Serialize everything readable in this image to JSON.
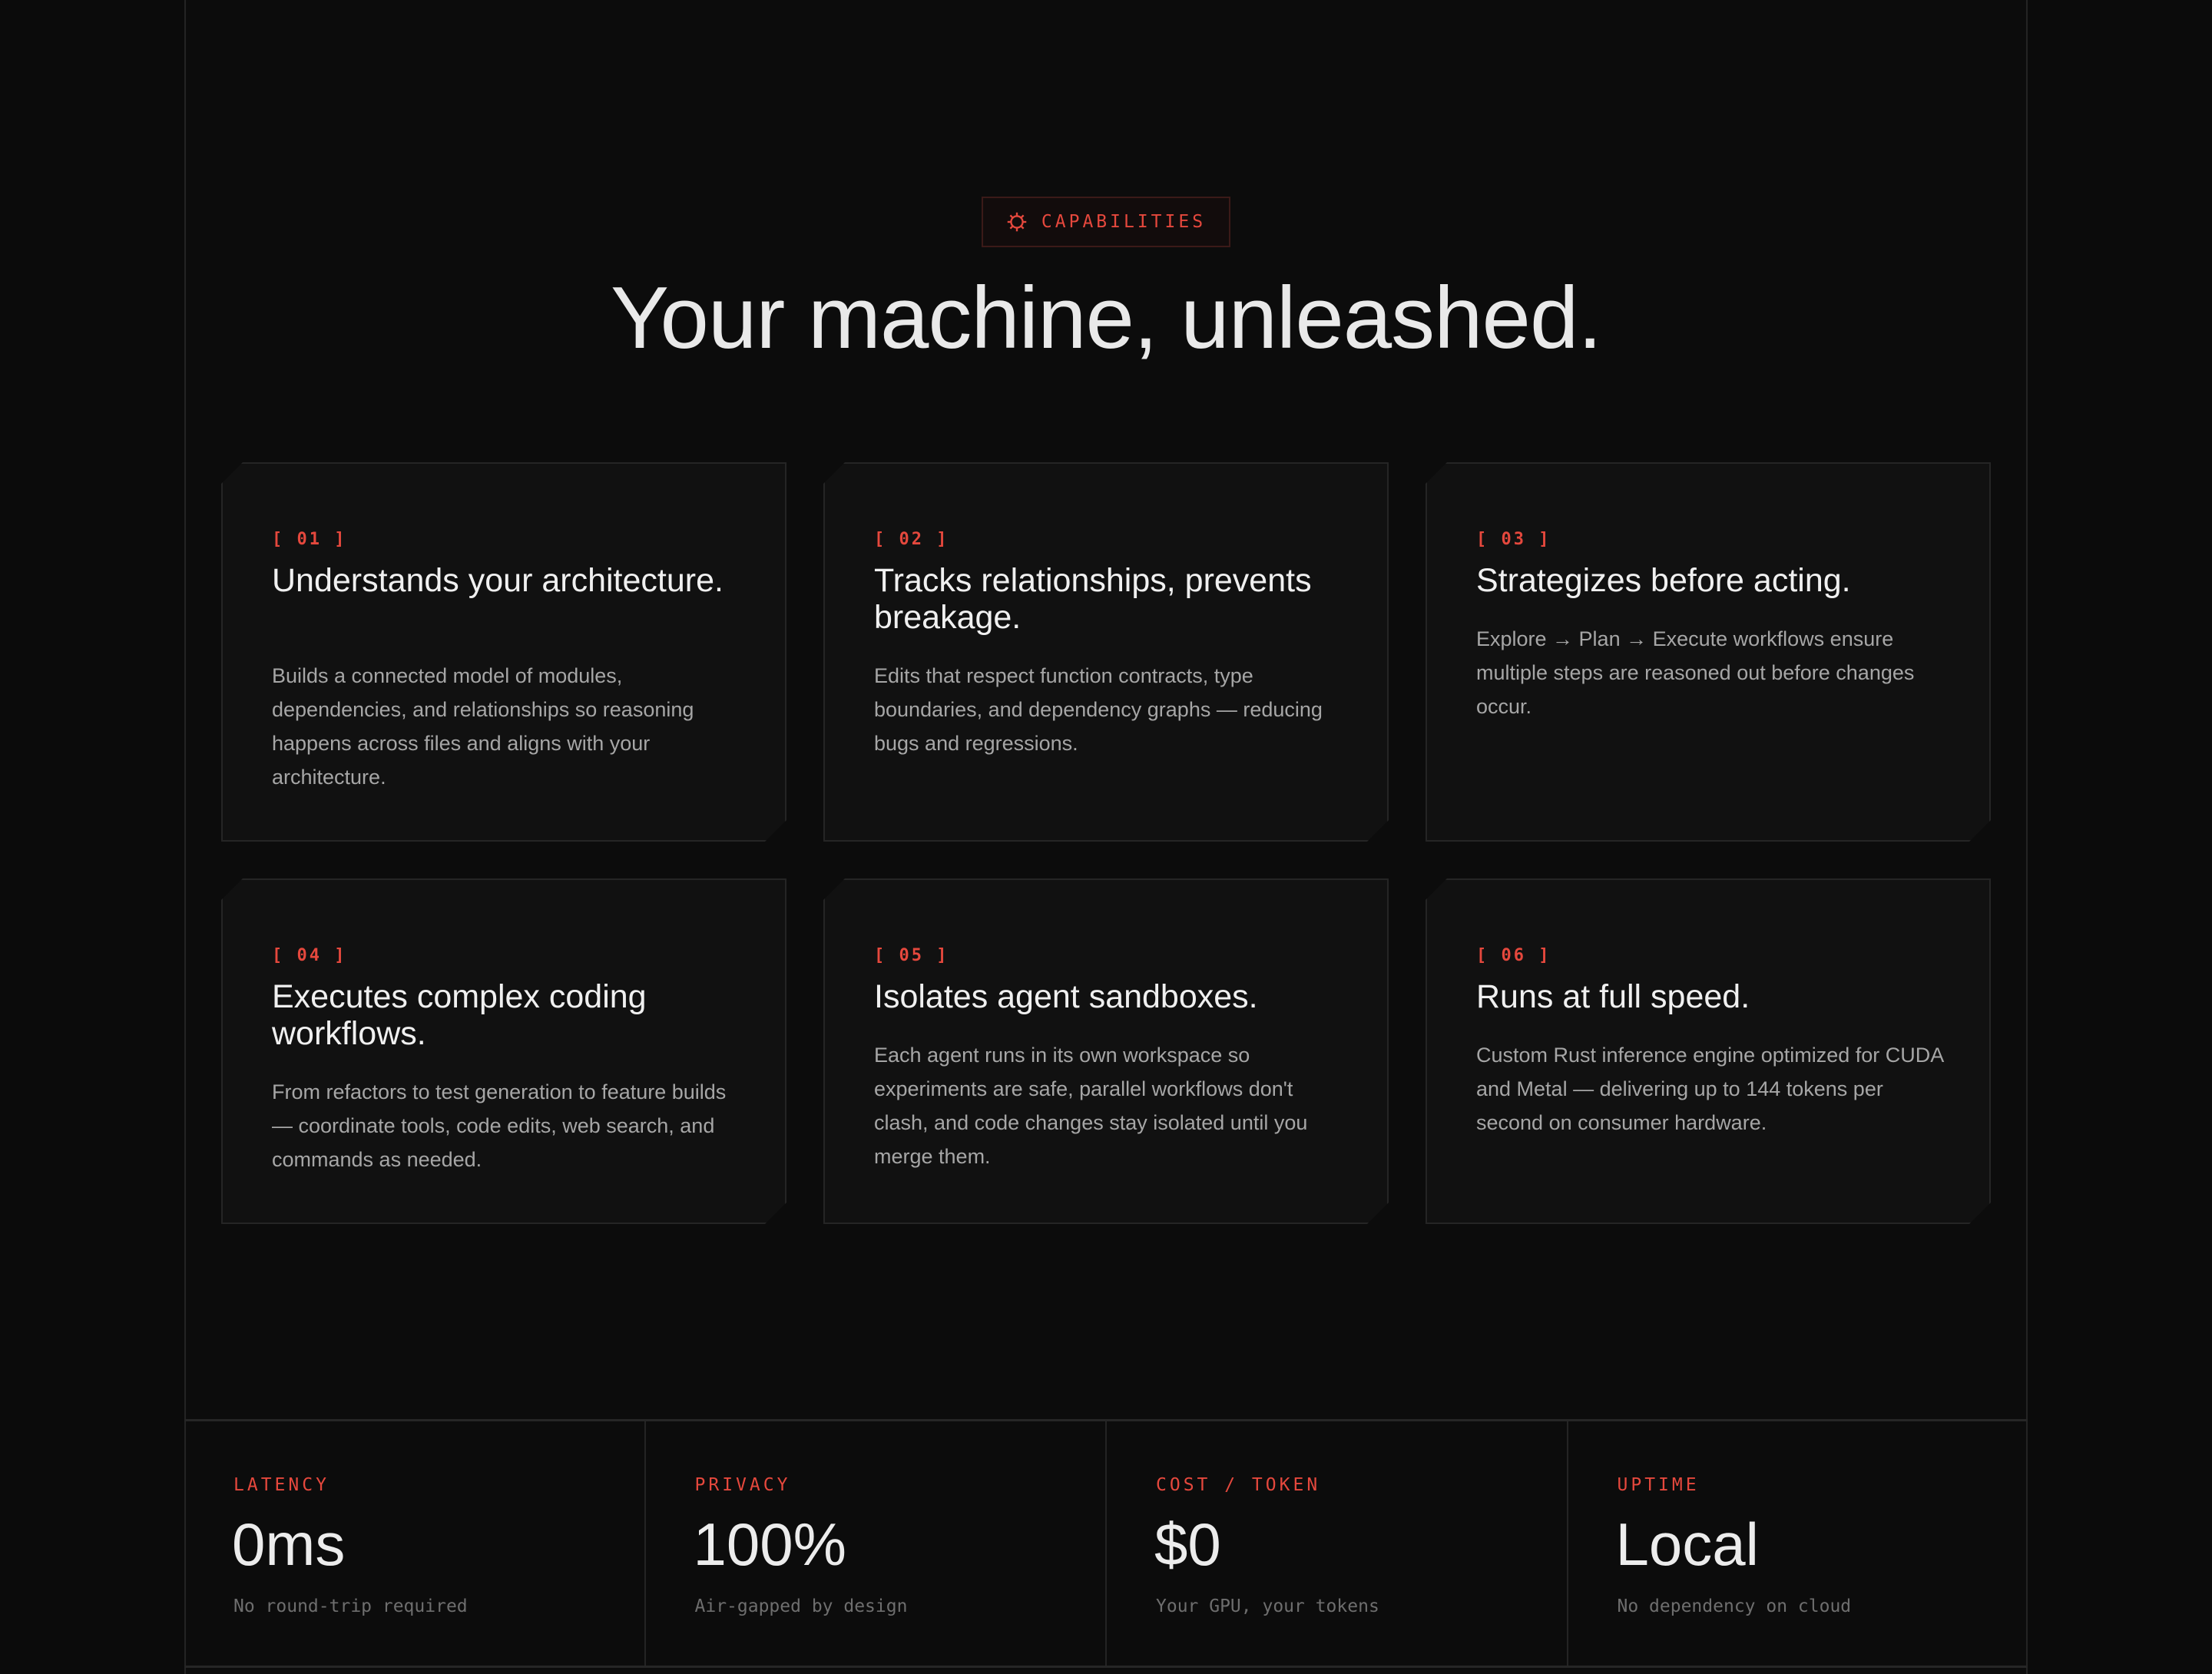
{
  "section": {
    "badge_icon": "gear-icon",
    "badge_label": "CAPABILITIES",
    "heading": "Your machine, unleashed."
  },
  "capabilities": [
    {
      "number": "[ 01 ]",
      "title": "Understands your architecture.",
      "description": "Builds a connected model of modules, dependencies, and relationships so reasoning happens across files and aligns with your architecture."
    },
    {
      "number": "[ 02 ]",
      "title": "Tracks relationships, prevents breakage.",
      "description": "Edits that respect function contracts, type boundaries, and dependency graphs — reducing bugs and regressions."
    },
    {
      "number": "[ 03 ]",
      "title": "Strategizes before acting.",
      "description": "Explore → Plan → Execute workflows ensure multiple steps are reasoned out before changes occur."
    },
    {
      "number": "[ 04 ]",
      "title": "Executes complex coding workflows.",
      "description": "From refactors to test generation to feature builds — coordinate tools, code edits, web search, and commands as needed."
    },
    {
      "number": "[ 05 ]",
      "title": "Isolates agent sandboxes.",
      "description": "Each agent runs in its own workspace so experiments are safe, parallel workflows don't clash, and code changes stay isolated until you merge them."
    },
    {
      "number": "[ 06 ]",
      "title": "Runs at full speed.",
      "description": "Custom Rust inference engine optimized for CUDA and Metal — delivering up to 144 tokens per second on consumer hardware."
    }
  ],
  "stats": [
    {
      "label": "LATENCY",
      "value": "0ms",
      "note": "No round-trip required"
    },
    {
      "label": "PRIVACY",
      "value": "100%",
      "note": "Air-gapped by design"
    },
    {
      "label": "COST / TOKEN",
      "value": "$0",
      "note": "Your GPU, your tokens"
    },
    {
      "label": "UPTIME",
      "value": "Local",
      "note": "No dependency on cloud"
    }
  ],
  "colors": {
    "background": "#0b0b0b",
    "accent": "#e5483d",
    "card_background": "#111111",
    "text_primary": "#ececec",
    "text_secondary": "#a6a6a6",
    "text_muted": "#6e6e6e"
  }
}
